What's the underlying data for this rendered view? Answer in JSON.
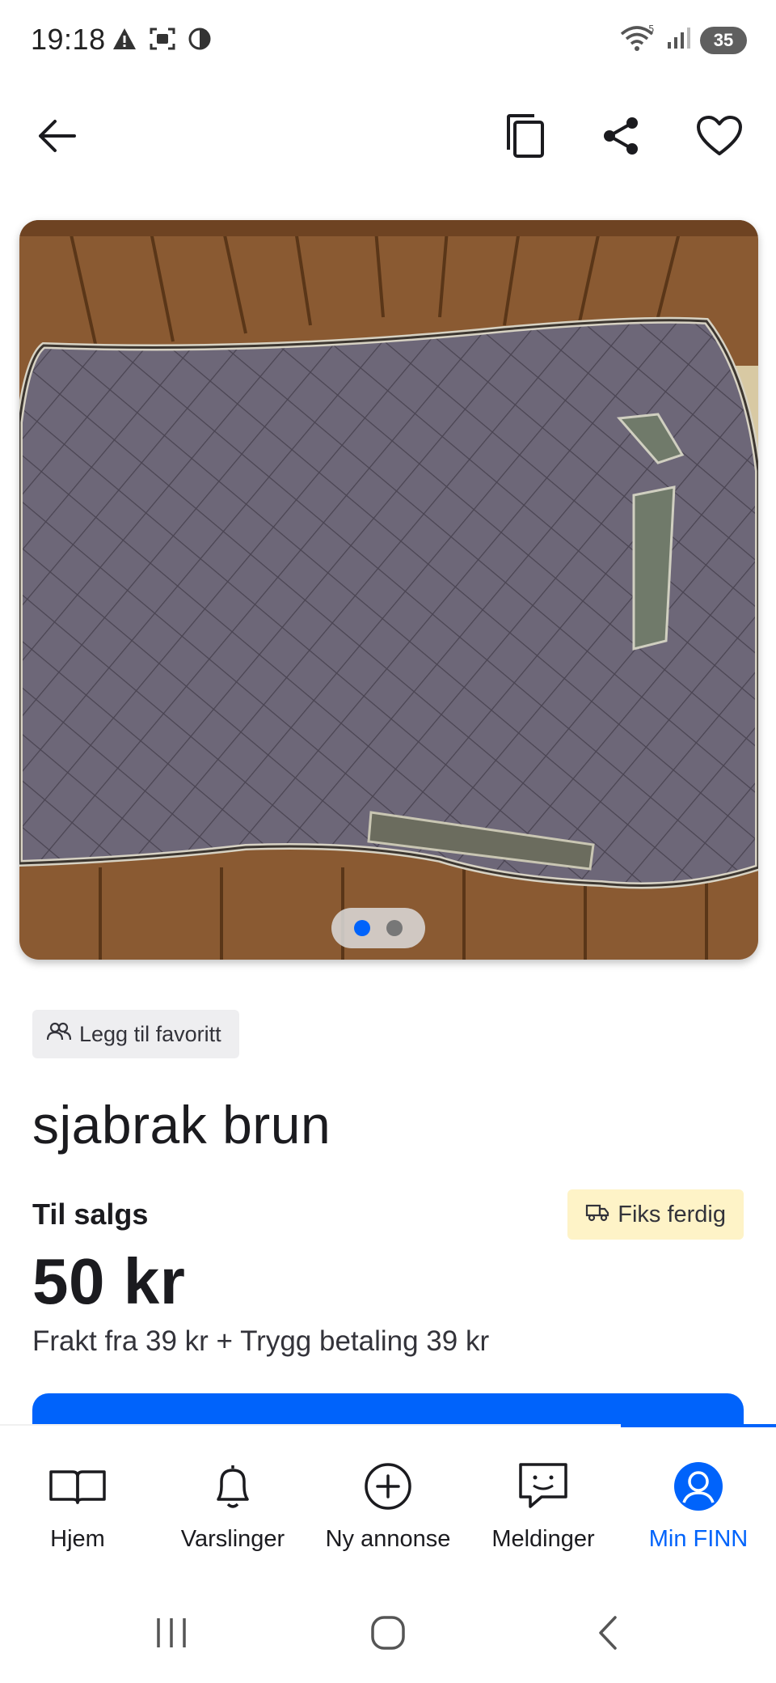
{
  "status_bar": {
    "time": "19:18",
    "left_icons": [
      "warning-icon",
      "screenshot-icon",
      "data-saver-icon"
    ],
    "right_icons": [
      "wifi-icon",
      "signal-icon"
    ],
    "battery": "35"
  },
  "toolbar": {
    "back_icon": "arrow-left-icon",
    "copy_icon": "copy-icon",
    "share_icon": "share-icon",
    "favorite_icon": "heart-icon"
  },
  "carousel": {
    "image_description_icon": "saddle-pad-photo",
    "page_count": 2,
    "active_index": 0
  },
  "listing": {
    "favorite_chip_label": "Legg til favoritt",
    "title": "sjabrak brun",
    "sale_type": "Til salgs",
    "fiks_ferdig_label": "Fiks ferdig",
    "price": "50 kr",
    "shipping_info": "Frakt fra 39 kr + Trygg betaling 39 kr"
  },
  "bottom_nav": {
    "items": [
      {
        "label": "Hjem",
        "icon": "book-icon"
      },
      {
        "label": "Varslinger",
        "icon": "bell-icon"
      },
      {
        "label": "Ny annonse",
        "icon": "plus-circle-icon"
      },
      {
        "label": "Meldinger",
        "icon": "chat-icon"
      },
      {
        "label": "Min FINN",
        "icon": "profile-icon"
      }
    ],
    "active": "Min FINN"
  },
  "colors": {
    "accent": "#0063fb",
    "badge_bg": "#fef3c7",
    "chip_bg": "#eeeef0"
  }
}
